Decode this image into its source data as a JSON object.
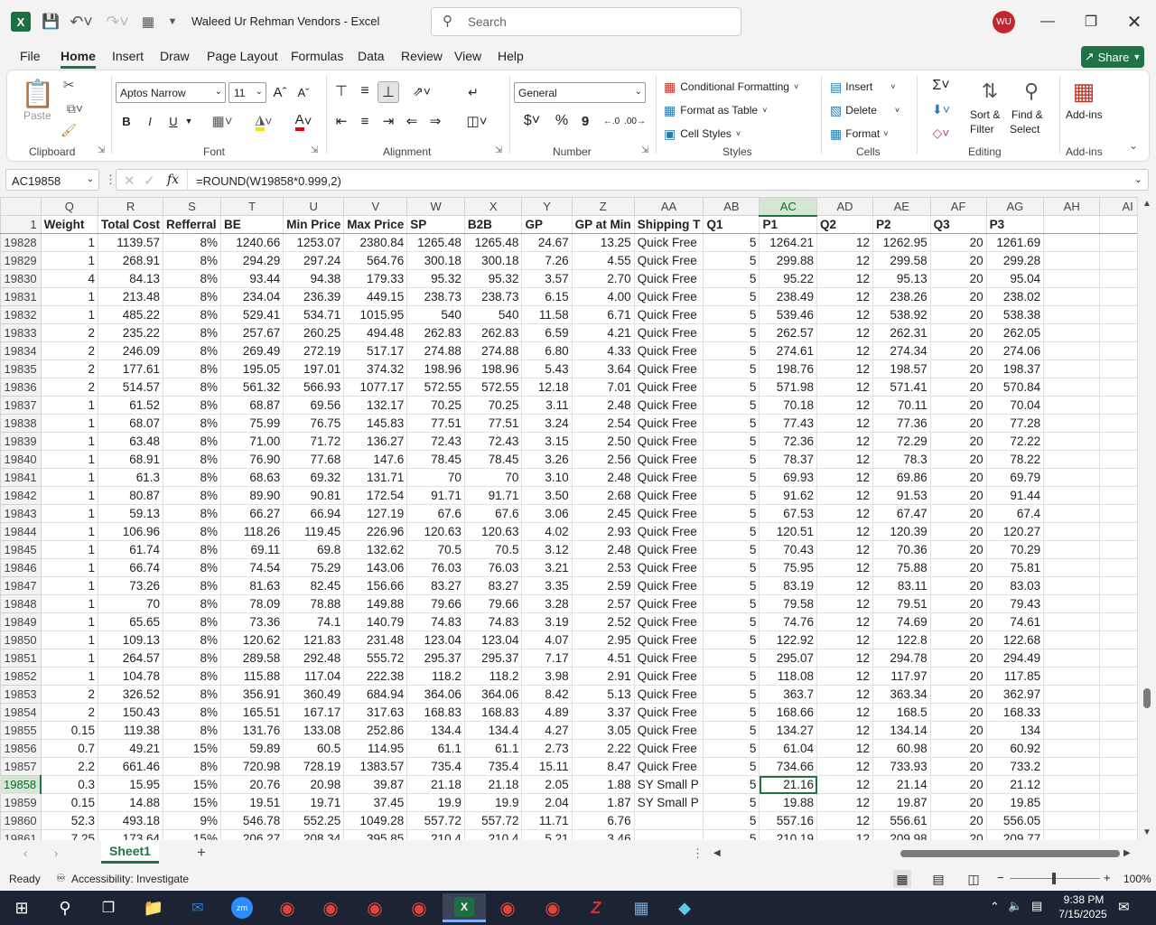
{
  "app": {
    "title": "Waleed Ur Rehman Vendors  -  Excel",
    "search_placeholder": "Search",
    "avatar_initials": "WU",
    "accent": "#217346"
  },
  "menu": {
    "items": [
      "File",
      "Home",
      "Insert",
      "Draw",
      "Page Layout",
      "Formulas",
      "Data",
      "Review",
      "View",
      "Help"
    ],
    "active": "Home",
    "share_label": "Share"
  },
  "ribbon": {
    "clipboard": {
      "paste": "Paste",
      "group": "Clipboard"
    },
    "font": {
      "name": "Aptos Narrow",
      "size": "11",
      "group": "Font",
      "bold": "B",
      "italic": "I",
      "underline": "U"
    },
    "alignment": {
      "group": "Alignment"
    },
    "number": {
      "format": "General",
      "group": "Number",
      "currency": "$",
      "percent": "%",
      "comma": "9"
    },
    "styles": {
      "cond": "Conditional Formatting",
      "table": "Format as Table",
      "cell": "Cell Styles",
      "group": "Styles"
    },
    "cells": {
      "insert": "Insert",
      "delete": "Delete",
      "format": "Format",
      "group": "Cells"
    },
    "editing": {
      "sort1": "Sort &",
      "sort2": "Filter",
      "find1": "Find &",
      "find2": "Select",
      "group": "Editing"
    },
    "addins": {
      "label": "Add-ins",
      "group": "Add-ins"
    }
  },
  "formula_bar": {
    "name_box": "AC19858",
    "fx": "fx",
    "formula": "=ROUND(W19858*0.999,2)"
  },
  "grid": {
    "columns": [
      "Q",
      "R",
      "S",
      "T",
      "U",
      "V",
      "W",
      "X",
      "Y",
      "Z",
      "AA",
      "AB",
      "AC",
      "AD",
      "AE",
      "AF",
      "AG",
      "AH",
      "AI"
    ],
    "selected_column": "AC",
    "header_row_number": "1",
    "headers": [
      "Weight",
      "Total Cost",
      "Refferral",
      "BE",
      "Min Price",
      "Max Price",
      "SP",
      "B2B",
      "GP",
      "GP at Min",
      "Shipping T",
      "Q1",
      "P1",
      "Q2",
      "P2",
      "Q3",
      "P3",
      "",
      ""
    ],
    "selected_row": "19858",
    "rows": [
      [
        "19828",
        "1",
        "1139.57",
        "8%",
        "1240.66",
        "1253.07",
        "2380.84",
        "1265.48",
        "1265.48",
        "24.67",
        "13.25",
        "Quick Free",
        "5",
        "1264.21",
        "12",
        "1262.95",
        "20",
        "1261.69"
      ],
      [
        "19829",
        "1",
        "268.91",
        "8%",
        "294.29",
        "297.24",
        "564.76",
        "300.18",
        "300.18",
        "7.26",
        "4.55",
        "Quick Free",
        "5",
        "299.88",
        "12",
        "299.58",
        "20",
        "299.28"
      ],
      [
        "19830",
        "4",
        "84.13",
        "8%",
        "93.44",
        "94.38",
        "179.33",
        "95.32",
        "95.32",
        "3.57",
        "2.70",
        "Quick Free",
        "5",
        "95.22",
        "12",
        "95.13",
        "20",
        "95.04"
      ],
      [
        "19831",
        "1",
        "213.48",
        "8%",
        "234.04",
        "236.39",
        "449.15",
        "238.73",
        "238.73",
        "6.15",
        "4.00",
        "Quick Free",
        "5",
        "238.49",
        "12",
        "238.26",
        "20",
        "238.02"
      ],
      [
        "19832",
        "1",
        "485.22",
        "8%",
        "529.41",
        "534.71",
        "1015.95",
        "540",
        "540",
        "11.58",
        "6.71",
        "Quick Free",
        "5",
        "539.46",
        "12",
        "538.92",
        "20",
        "538.38"
      ],
      [
        "19833",
        "2",
        "235.22",
        "8%",
        "257.67",
        "260.25",
        "494.48",
        "262.83",
        "262.83",
        "6.59",
        "4.21",
        "Quick Free",
        "5",
        "262.57",
        "12",
        "262.31",
        "20",
        "262.05"
      ],
      [
        "19834",
        "2",
        "246.09",
        "8%",
        "269.49",
        "272.19",
        "517.17",
        "274.88",
        "274.88",
        "6.80",
        "4.33",
        "Quick Free",
        "5",
        "274.61",
        "12",
        "274.34",
        "20",
        "274.06"
      ],
      [
        "19835",
        "2",
        "177.61",
        "8%",
        "195.05",
        "197.01",
        "374.32",
        "198.96",
        "198.96",
        "5.43",
        "3.64",
        "Quick Free",
        "5",
        "198.76",
        "12",
        "198.57",
        "20",
        "198.37"
      ],
      [
        "19836",
        "2",
        "514.57",
        "8%",
        "561.32",
        "566.93",
        "1077.17",
        "572.55",
        "572.55",
        "12.18",
        "7.01",
        "Quick Free",
        "5",
        "571.98",
        "12",
        "571.41",
        "20",
        "570.84"
      ],
      [
        "19837",
        "1",
        "61.52",
        "8%",
        "68.87",
        "69.56",
        "132.17",
        "70.25",
        "70.25",
        "3.11",
        "2.48",
        "Quick Free",
        "5",
        "70.18",
        "12",
        "70.11",
        "20",
        "70.04"
      ],
      [
        "19838",
        "1",
        "68.07",
        "8%",
        "75.99",
        "76.75",
        "145.83",
        "77.51",
        "77.51",
        "3.24",
        "2.54",
        "Quick Free",
        "5",
        "77.43",
        "12",
        "77.36",
        "20",
        "77.28"
      ],
      [
        "19839",
        "1",
        "63.48",
        "8%",
        "71.00",
        "71.72",
        "136.27",
        "72.43",
        "72.43",
        "3.15",
        "2.50",
        "Quick Free",
        "5",
        "72.36",
        "12",
        "72.29",
        "20",
        "72.22"
      ],
      [
        "19840",
        "1",
        "68.91",
        "8%",
        "76.90",
        "77.68",
        "147.6",
        "78.45",
        "78.45",
        "3.26",
        "2.56",
        "Quick Free",
        "5",
        "78.37",
        "12",
        "78.3",
        "20",
        "78.22"
      ],
      [
        "19841",
        "1",
        "61.3",
        "8%",
        "68.63",
        "69.32",
        "131.71",
        "70",
        "70",
        "3.10",
        "2.48",
        "Quick Free",
        "5",
        "69.93",
        "12",
        "69.86",
        "20",
        "69.79"
      ],
      [
        "19842",
        "1",
        "80.87",
        "8%",
        "89.90",
        "90.81",
        "172.54",
        "91.71",
        "91.71",
        "3.50",
        "2.68",
        "Quick Free",
        "5",
        "91.62",
        "12",
        "91.53",
        "20",
        "91.44"
      ],
      [
        "19843",
        "1",
        "59.13",
        "8%",
        "66.27",
        "66.94",
        "127.19",
        "67.6",
        "67.6",
        "3.06",
        "2.45",
        "Quick Free",
        "5",
        "67.53",
        "12",
        "67.47",
        "20",
        "67.4"
      ],
      [
        "19844",
        "1",
        "106.96",
        "8%",
        "118.26",
        "119.45",
        "226.96",
        "120.63",
        "120.63",
        "4.02",
        "2.93",
        "Quick Free",
        "5",
        "120.51",
        "12",
        "120.39",
        "20",
        "120.27"
      ],
      [
        "19845",
        "1",
        "61.74",
        "8%",
        "69.11",
        "69.8",
        "132.62",
        "70.5",
        "70.5",
        "3.12",
        "2.48",
        "Quick Free",
        "5",
        "70.43",
        "12",
        "70.36",
        "20",
        "70.29"
      ],
      [
        "19846",
        "1",
        "66.74",
        "8%",
        "74.54",
        "75.29",
        "143.06",
        "76.03",
        "76.03",
        "3.21",
        "2.53",
        "Quick Free",
        "5",
        "75.95",
        "12",
        "75.88",
        "20",
        "75.81"
      ],
      [
        "19847",
        "1",
        "73.26",
        "8%",
        "81.63",
        "82.45",
        "156.66",
        "83.27",
        "83.27",
        "3.35",
        "2.59",
        "Quick Free",
        "5",
        "83.19",
        "12",
        "83.11",
        "20",
        "83.03"
      ],
      [
        "19848",
        "1",
        "70",
        "8%",
        "78.09",
        "78.88",
        "149.88",
        "79.66",
        "79.66",
        "3.28",
        "2.57",
        "Quick Free",
        "5",
        "79.58",
        "12",
        "79.51",
        "20",
        "79.43"
      ],
      [
        "19849",
        "1",
        "65.65",
        "8%",
        "73.36",
        "74.1",
        "140.79",
        "74.83",
        "74.83",
        "3.19",
        "2.52",
        "Quick Free",
        "5",
        "74.76",
        "12",
        "74.69",
        "20",
        "74.61"
      ],
      [
        "19850",
        "1",
        "109.13",
        "8%",
        "120.62",
        "121.83",
        "231.48",
        "123.04",
        "123.04",
        "4.07",
        "2.95",
        "Quick Free",
        "5",
        "122.92",
        "12",
        "122.8",
        "20",
        "122.68"
      ],
      [
        "19851",
        "1",
        "264.57",
        "8%",
        "289.58",
        "292.48",
        "555.72",
        "295.37",
        "295.37",
        "7.17",
        "4.51",
        "Quick Free",
        "5",
        "295.07",
        "12",
        "294.78",
        "20",
        "294.49"
      ],
      [
        "19852",
        "1",
        "104.78",
        "8%",
        "115.88",
        "117.04",
        "222.38",
        "118.2",
        "118.2",
        "3.98",
        "2.91",
        "Quick Free",
        "5",
        "118.08",
        "12",
        "117.97",
        "20",
        "117.85"
      ],
      [
        "19853",
        "2",
        "326.52",
        "8%",
        "356.91",
        "360.49",
        "684.94",
        "364.06",
        "364.06",
        "8.42",
        "5.13",
        "Quick Free",
        "5",
        "363.7",
        "12",
        "363.34",
        "20",
        "362.97"
      ],
      [
        "19854",
        "2",
        "150.43",
        "8%",
        "165.51",
        "167.17",
        "317.63",
        "168.83",
        "168.83",
        "4.89",
        "3.37",
        "Quick Free",
        "5",
        "168.66",
        "12",
        "168.5",
        "20",
        "168.33"
      ],
      [
        "19855",
        "0.15",
        "119.38",
        "8%",
        "131.76",
        "133.08",
        "252.86",
        "134.4",
        "134.4",
        "4.27",
        "3.05",
        "Quick Free",
        "5",
        "134.27",
        "12",
        "134.14",
        "20",
        "134"
      ],
      [
        "19856",
        "0.7",
        "49.21",
        "15%",
        "59.89",
        "60.5",
        "114.95",
        "61.1",
        "61.1",
        "2.73",
        "2.22",
        "Quick Free",
        "5",
        "61.04",
        "12",
        "60.98",
        "20",
        "60.92"
      ],
      [
        "19857",
        "2.2",
        "661.46",
        "8%",
        "720.98",
        "728.19",
        "1383.57",
        "735.4",
        "735.4",
        "15.11",
        "8.47",
        "Quick Free",
        "5",
        "734.66",
        "12",
        "733.93",
        "20",
        "733.2"
      ],
      [
        "19858",
        "0.3",
        "15.95",
        "15%",
        "20.76",
        "20.98",
        "39.87",
        "21.18",
        "21.18",
        "2.05",
        "1.88",
        "SY Small P",
        "5",
        "21.16",
        "12",
        "21.14",
        "20",
        "21.12"
      ],
      [
        "19859",
        "0.15",
        "14.88",
        "15%",
        "19.51",
        "19.71",
        "37.45",
        "19.9",
        "19.9",
        "2.04",
        "1.87",
        "SY Small P",
        "5",
        "19.88",
        "12",
        "19.87",
        "20",
        "19.85"
      ],
      [
        "19860",
        "52.3",
        "493.18",
        "9%",
        "546.78",
        "552.25",
        "1049.28",
        "557.72",
        "557.72",
        "11.71",
        "6.76",
        "",
        "5",
        "557.16",
        "12",
        "556.61",
        "20",
        "556.05"
      ],
      [
        "19861",
        "7.25",
        "173.64",
        "15%",
        "206.27",
        "208.34",
        "395.85",
        "210.4",
        "210.4",
        "5.21",
        "3.46",
        "",
        "5",
        "210.19",
        "12",
        "209.98",
        "20",
        "209.77"
      ]
    ]
  },
  "sheets": {
    "tabs": [
      "Sheet1"
    ],
    "add": "+"
  },
  "status": {
    "ready": "Ready",
    "accessibility": "Accessibility: Investigate",
    "zoom": "100%"
  },
  "taskbar": {
    "time": "9:38 PM",
    "date": "7/15/2025"
  }
}
